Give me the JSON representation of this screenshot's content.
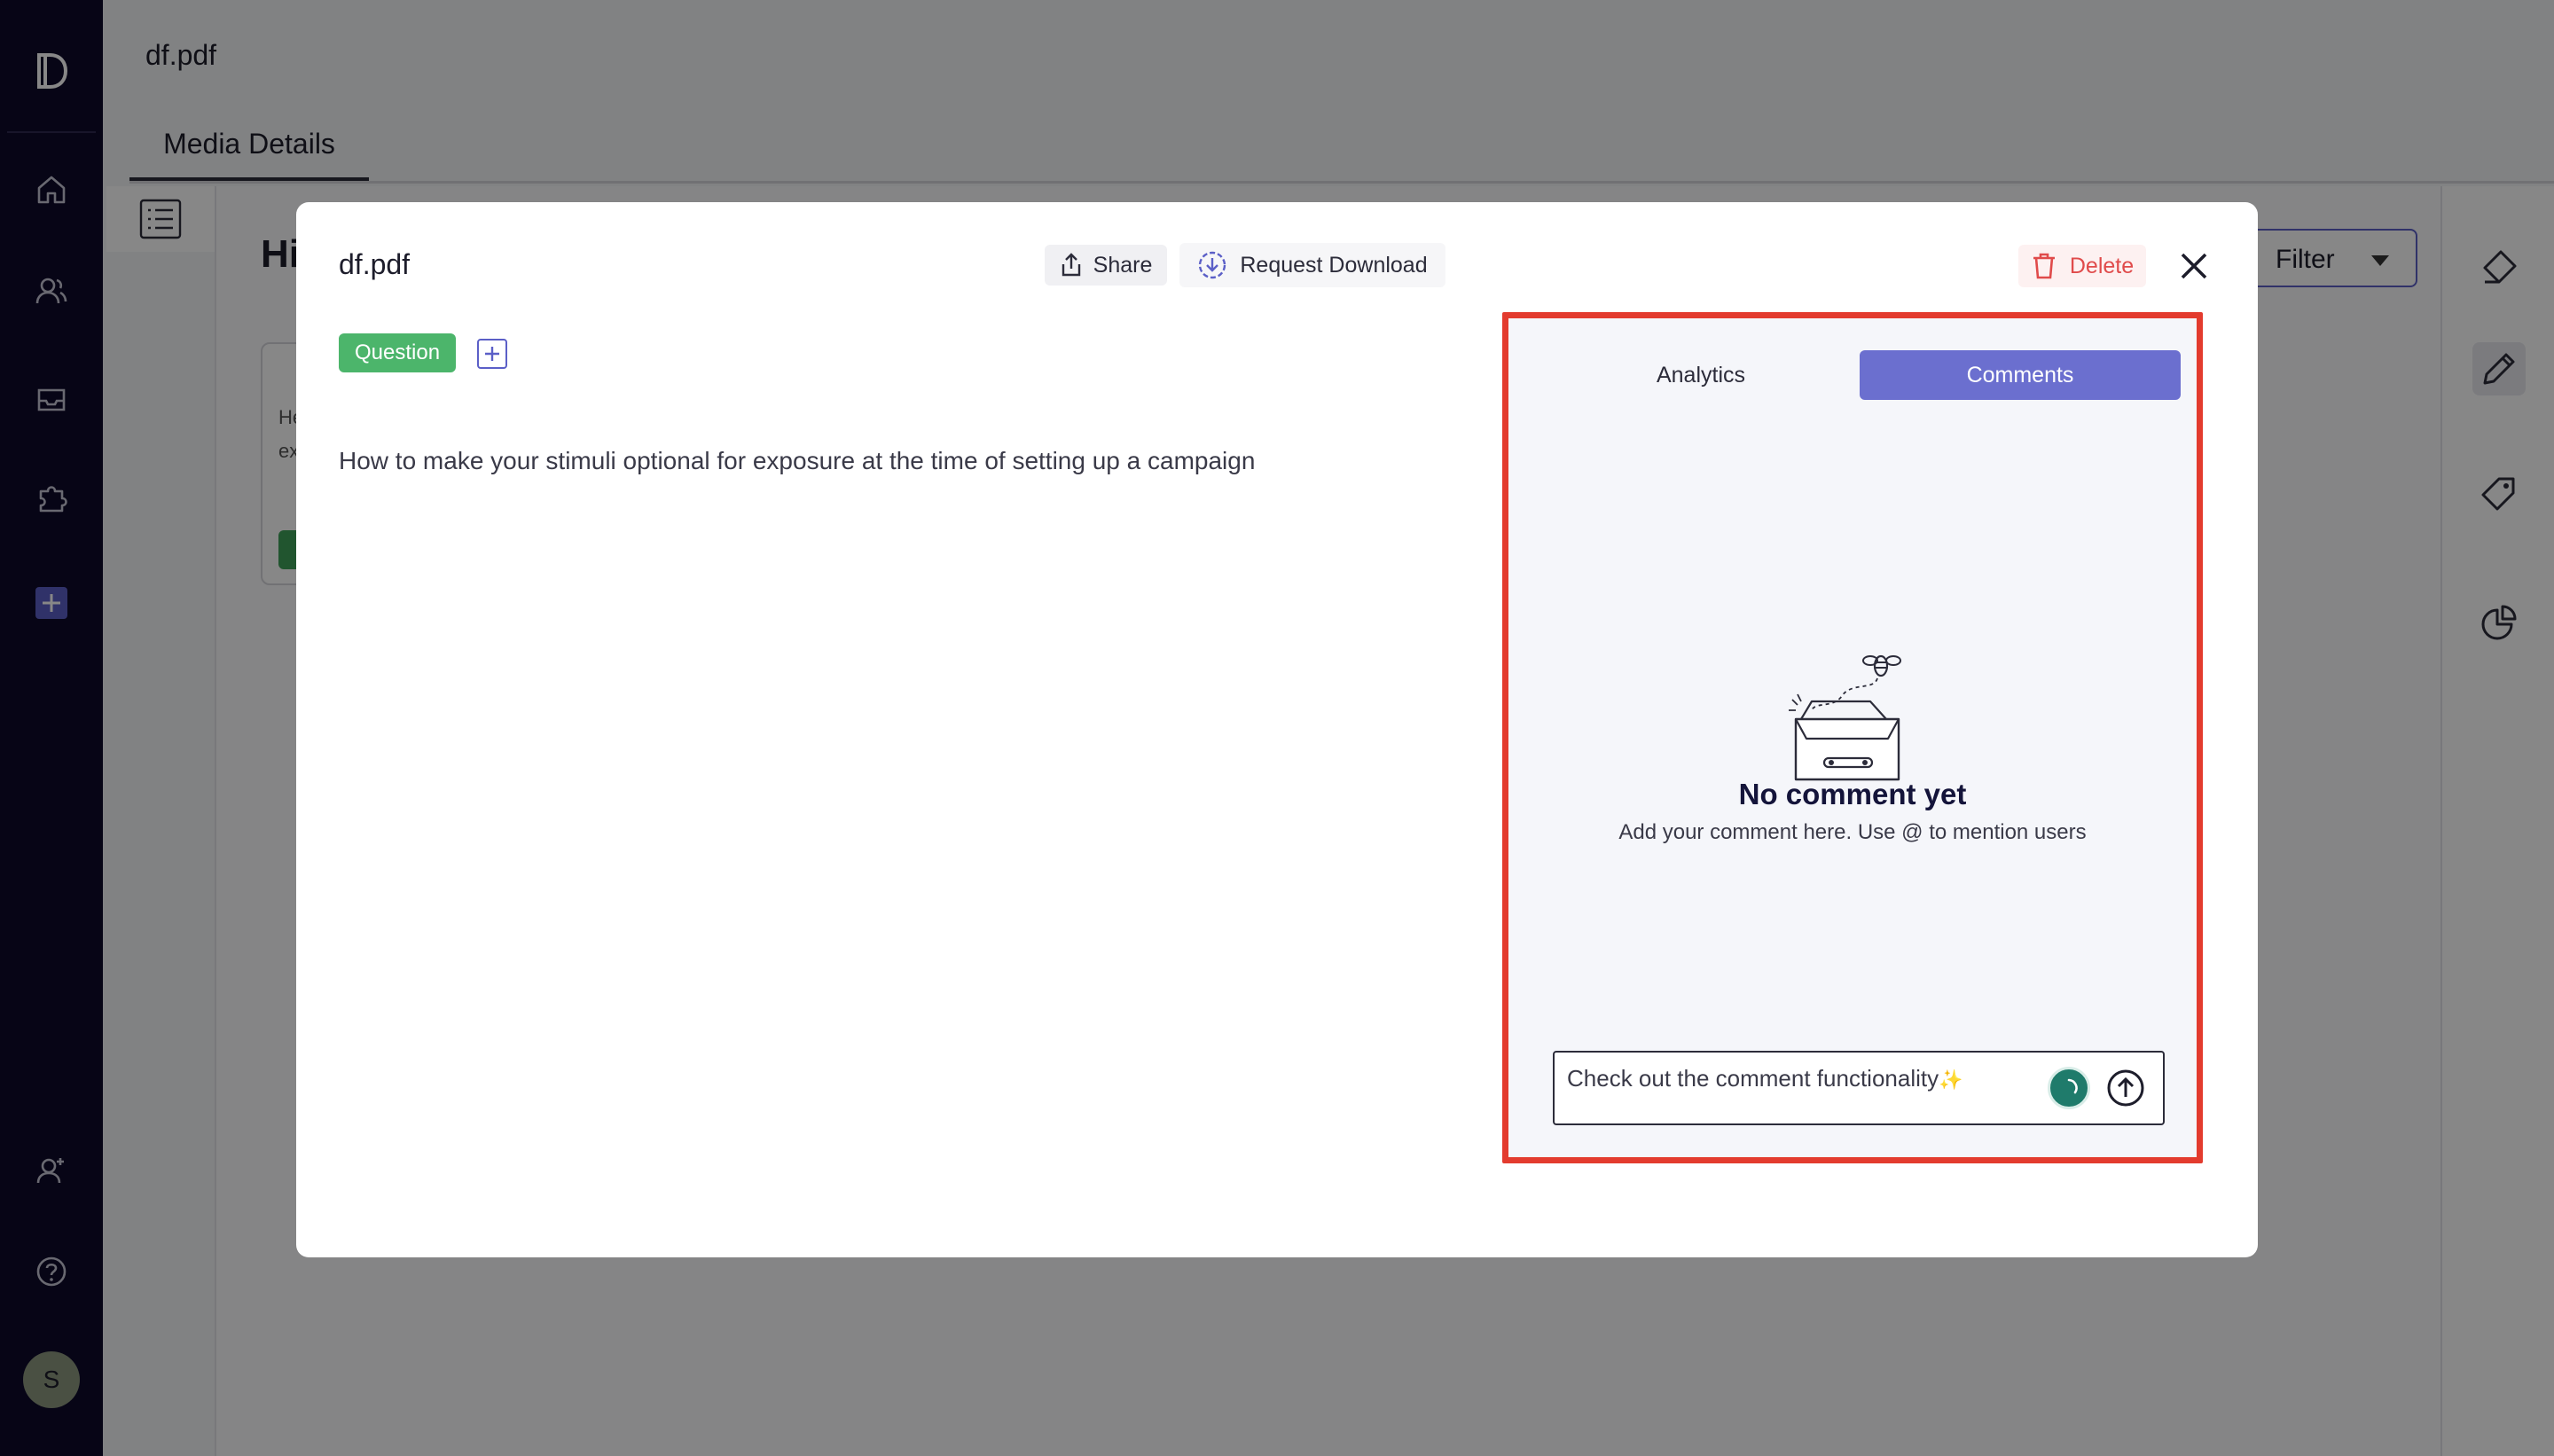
{
  "app": {
    "logo_letter": "D",
    "page_title": "df.pdf",
    "tab_label": "Media Details",
    "background_heading": "Hi",
    "background_card": {
      "line1": "He",
      "line2": "ex"
    },
    "filter_label": "Filter",
    "avatar_initial": "S"
  },
  "modal": {
    "title": "df.pdf",
    "share_label": "Share",
    "request_download_label": "Request Download",
    "delete_label": "Delete",
    "tag_label": "Question",
    "description": "How to make your stimuli optional for exposure at the time of setting up a campaign"
  },
  "panel": {
    "tabs": [
      {
        "label": "Analytics",
        "active": false
      },
      {
        "label": "Comments",
        "active": true
      }
    ],
    "empty_title": "No comment yet",
    "empty_subtitle": "Add your comment here. Use @ to mention users",
    "comment_input_value": "Check out the comment functionality",
    "comment_input_emoji": "✨"
  },
  "colors": {
    "rail_bg": "#0f0a2a",
    "accent": "#6b6fcf",
    "tag_green": "#4cb56b",
    "delete_red": "#e04b4b",
    "highlight_border": "#e33b2e"
  }
}
